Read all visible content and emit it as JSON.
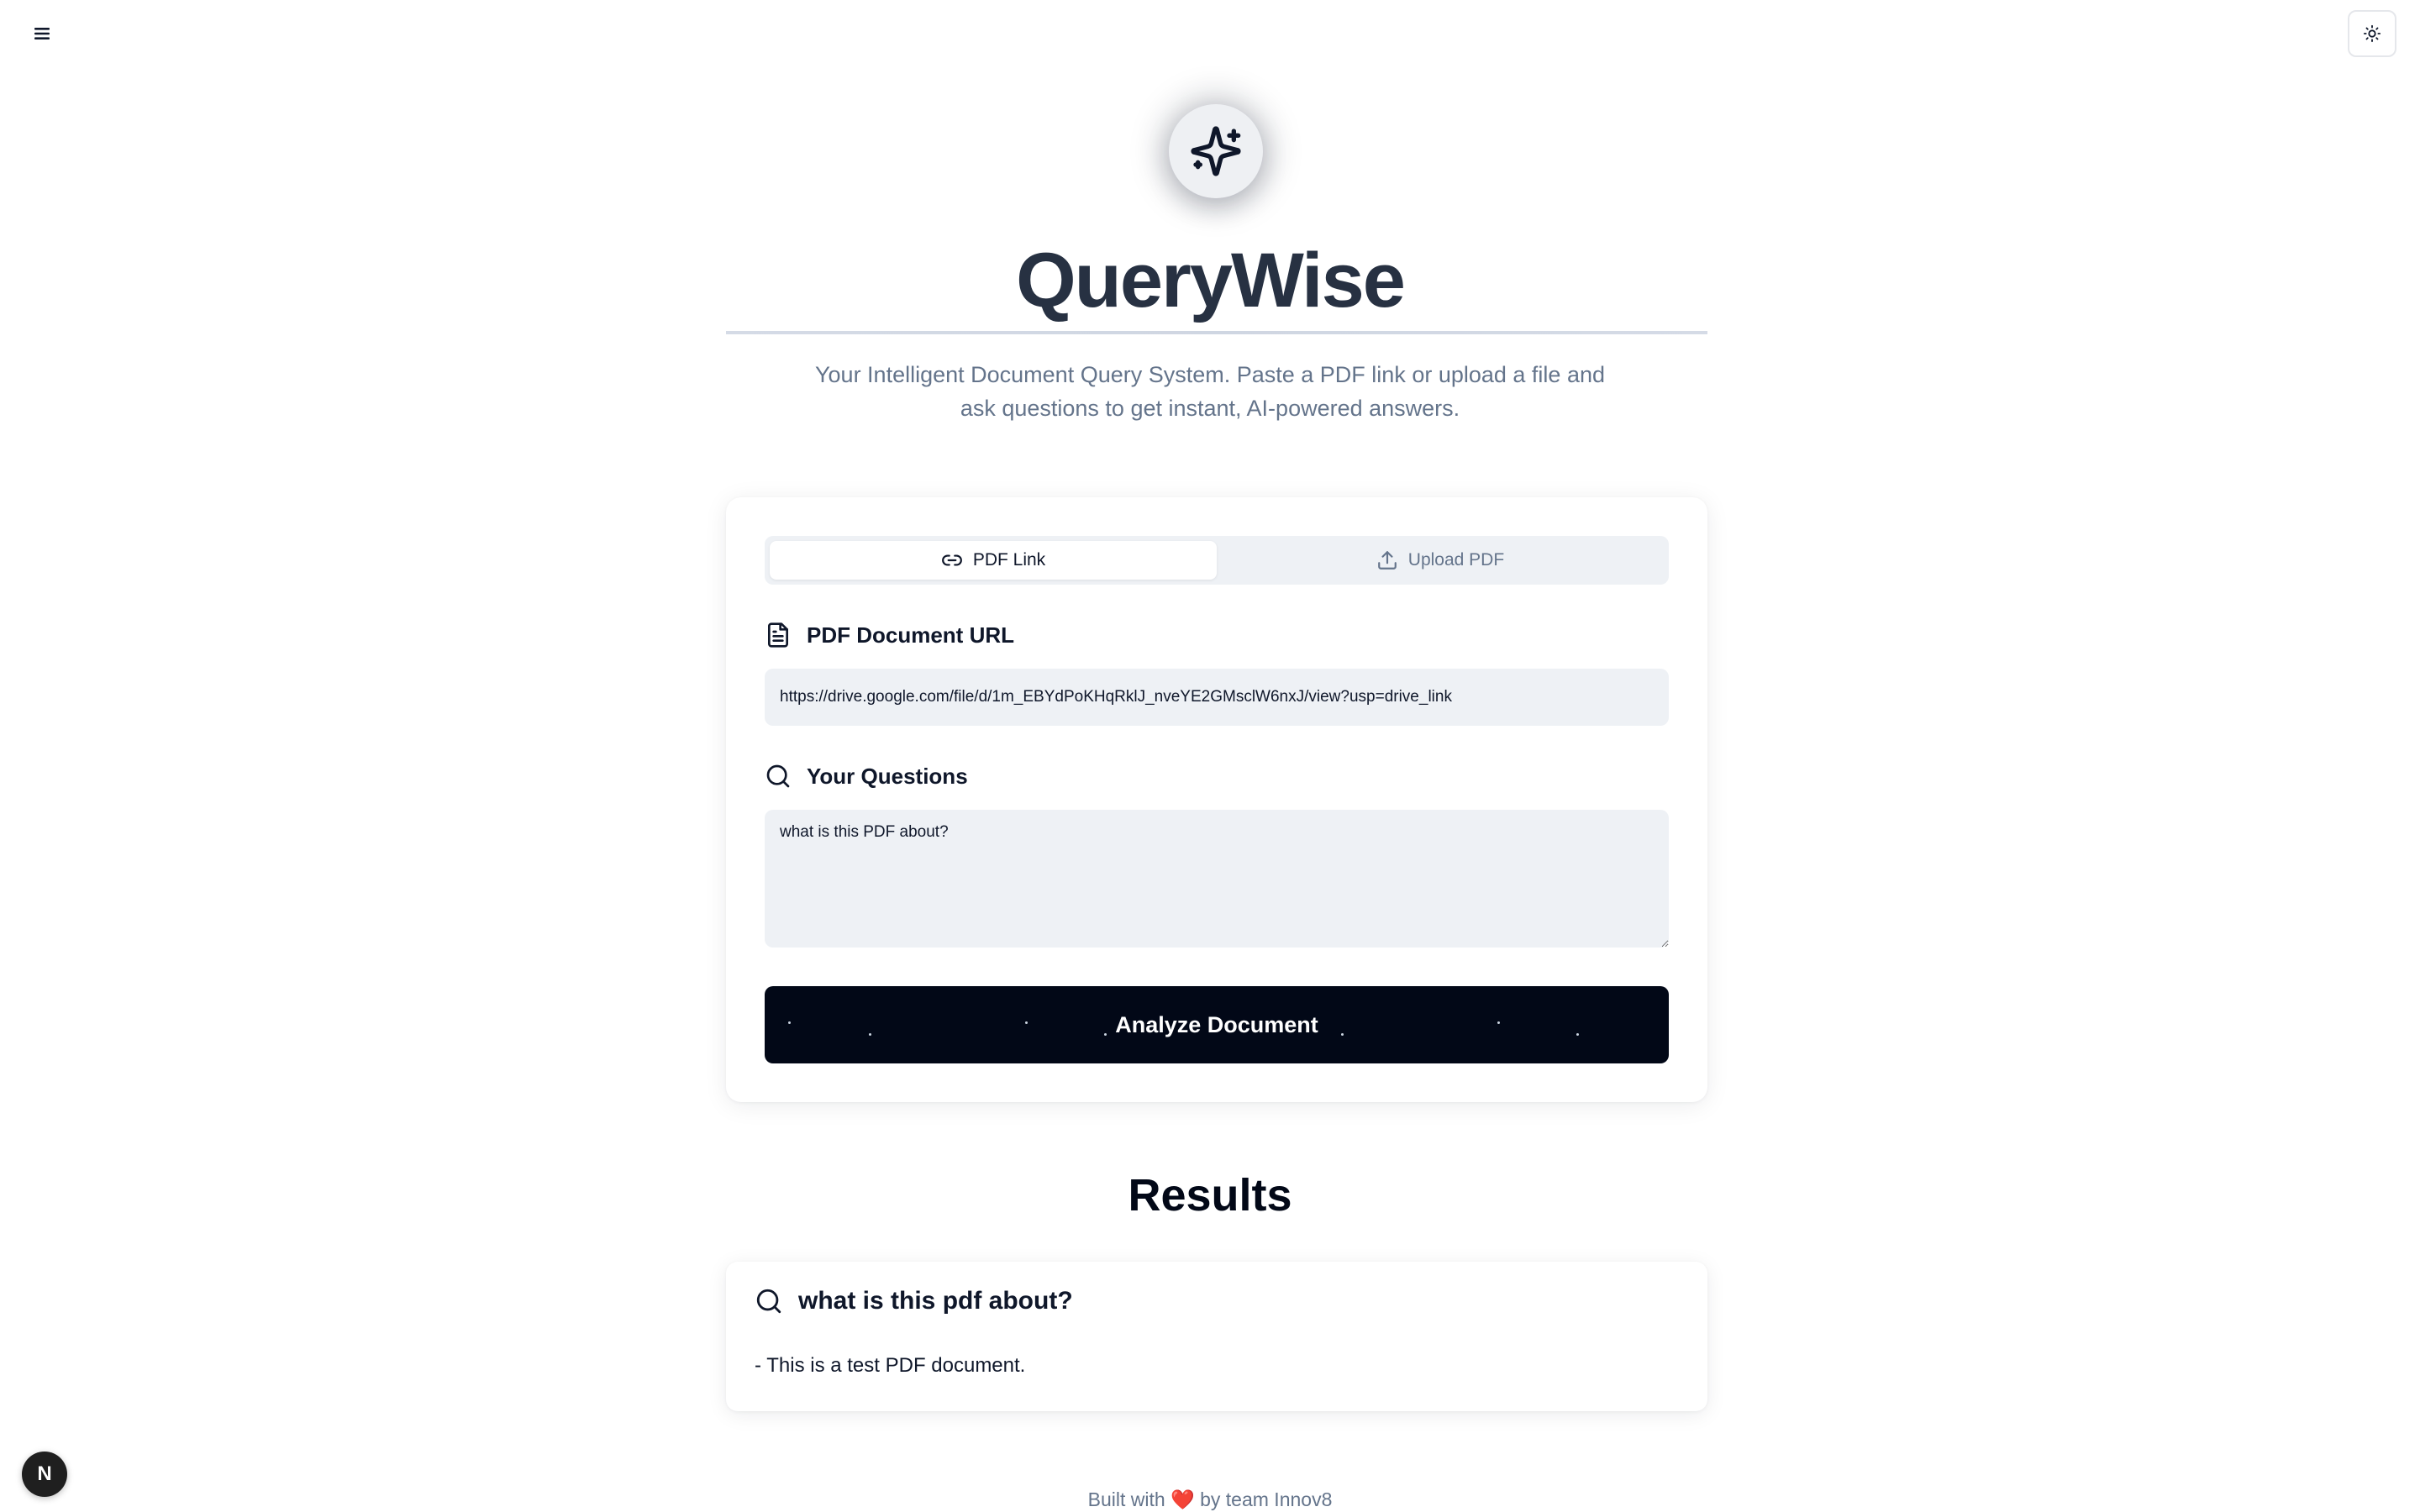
{
  "app": {
    "title": "QueryWise",
    "subtitle": "Your Intelligent Document Query System. Paste a PDF link or upload a file and ask questions to get instant, AI-powered answers."
  },
  "header": {
    "menu_icon": "hamburger-menu-icon",
    "theme_icon": "sun-icon"
  },
  "tabs": [
    {
      "label": "PDF Link",
      "icon": "link-icon",
      "active": true
    },
    {
      "label": "Upload PDF",
      "icon": "upload-icon",
      "active": false
    }
  ],
  "form": {
    "url_label": "PDF Document URL",
    "url_value": "https://drive.google.com/file/d/1m_EBYdPoKHqRklJ_nveYE2GMsclW6nxJ/view?usp=drive_link",
    "questions_label": "Your Questions",
    "questions_value": "what is this PDF about?",
    "submit_label": "Analyze Document"
  },
  "results": {
    "title": "Results",
    "items": [
      {
        "question": "what is this pdf about?",
        "answer": "- This is a test PDF document."
      }
    ]
  },
  "footer": {
    "prefix": "Built with",
    "heart": "❤️",
    "suffix": "by team Innov8"
  },
  "dev_badge": {
    "label": "N"
  },
  "colors": {
    "primary_button": "#020817",
    "input_bg": "#eef1f5",
    "muted_text": "#64748b",
    "title_text": "#273142"
  }
}
